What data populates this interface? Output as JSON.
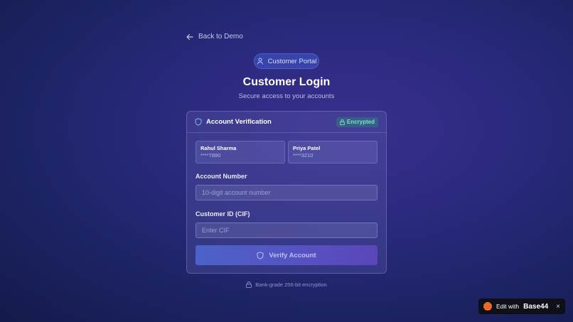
{
  "nav": {
    "back_label": "Back to Demo"
  },
  "badge": {
    "label": "Customer Portal"
  },
  "header": {
    "title": "Customer Login",
    "subtitle": "Secure access to your accounts"
  },
  "card": {
    "title": "Account Verification",
    "status_badge": "Encrypted",
    "accounts": [
      {
        "name": "Rahul Sharma",
        "number": "****7890"
      },
      {
        "name": "Priya Patel",
        "number": "****3210"
      }
    ],
    "account_number": {
      "label": "Account Number",
      "placeholder": "10-digit account number",
      "value": ""
    },
    "customer_id": {
      "label": "Customer ID (CIF)",
      "placeholder": "Enter CIF",
      "value": ""
    },
    "verify_label": "Verify Account"
  },
  "footer": {
    "note": "Bank-grade 256-bit encryption"
  },
  "base44_badge": {
    "prefix": "Edit with",
    "brand": "Base44",
    "close": "×"
  },
  "colors": {
    "accent": "#4b63c8",
    "encrypted_text": "#7fe3c4",
    "background": "#2a2a7e"
  },
  "icons": {
    "back": "arrow-left-icon",
    "portal": "user-icon",
    "card": "shield-icon",
    "encrypted": "lock-icon",
    "verify": "shield-icon",
    "footer": "lock-icon",
    "base44": "base44-logo-icon",
    "close": "close-icon"
  }
}
